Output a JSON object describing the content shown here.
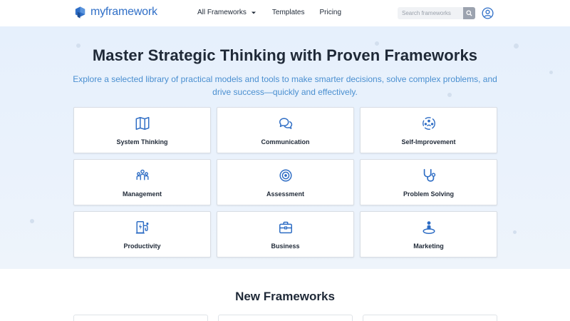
{
  "header": {
    "logo_text": "myframework",
    "nav": [
      {
        "label": "All Frameworks",
        "has_dropdown": true
      },
      {
        "label": "Templates"
      },
      {
        "label": "Pricing"
      }
    ],
    "search": {
      "placeholder": "Search frameworks",
      "icon": "search-icon"
    },
    "user_icon": "user-circle-icon"
  },
  "hero": {
    "title": "Master Strategic Thinking with Proven Frameworks",
    "subtitle": "Explore a selected library of practical models and tools to make smarter decisions, solve complex problems, and drive success—quickly and effectively."
  },
  "categories": [
    {
      "label": "System Thinking",
      "icon": "map-icon"
    },
    {
      "label": "Communication",
      "icon": "chat-bubbles-icon"
    },
    {
      "label": "Self-Improvement",
      "icon": "self-improvement-icon"
    },
    {
      "label": "Management",
      "icon": "team-icon"
    },
    {
      "label": "Assessment",
      "icon": "target-icon"
    },
    {
      "label": "Problem Solving",
      "icon": "stethoscope-icon"
    },
    {
      "label": "Productivity",
      "icon": "charging-station-icon"
    },
    {
      "label": "Business",
      "icon": "briefcase-icon"
    },
    {
      "label": "Marketing",
      "icon": "person-pin-icon"
    }
  ],
  "new_section": {
    "title": "New Frameworks"
  },
  "colors": {
    "accent": "#2f6fc7",
    "icon_blue": "#2d6cc4",
    "subtitle": "#4a8fd0",
    "hero_bg": "#e8f1fc",
    "text": "#1f2937"
  }
}
